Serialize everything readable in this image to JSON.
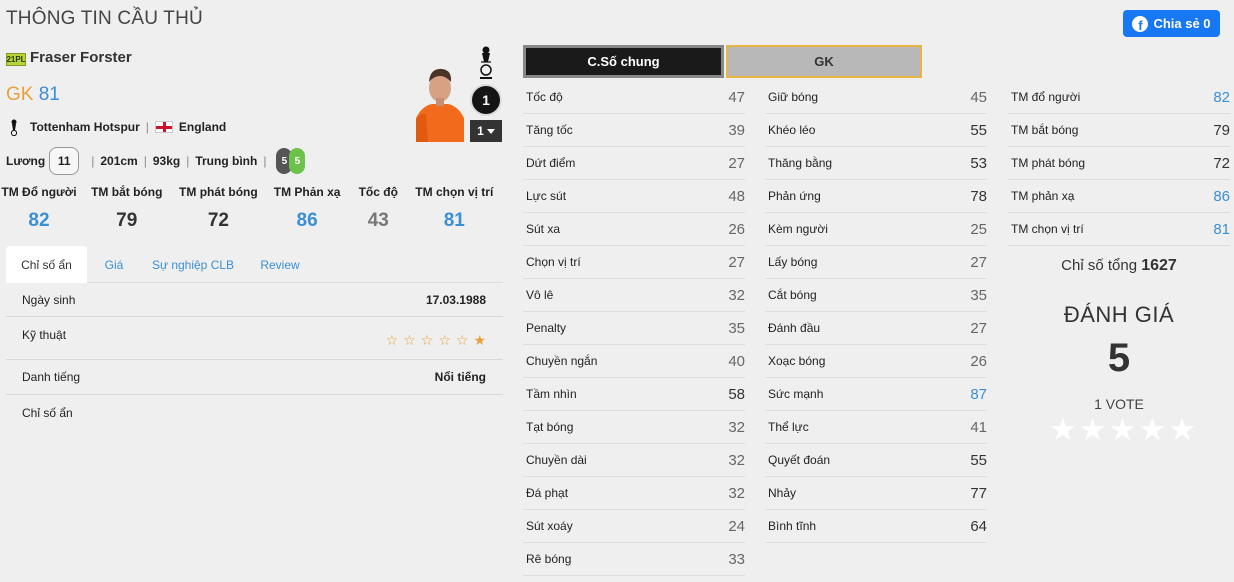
{
  "page_title": "THÔNG TIN CẦU THỦ",
  "share": {
    "label": "Chia sẻ 0",
    "fb_glyph": "f"
  },
  "player": {
    "season": "21PL",
    "name": "Fraser Forster",
    "position": "GK",
    "overall": "81",
    "club": "Tottenham Hotspur",
    "nation": "England",
    "wage_label": "Lương",
    "wage": "11",
    "height": "201cm",
    "weight": "93kg",
    "body_type": "Trung bình",
    "weak_foot_left": "5",
    "weak_foot_right": "5",
    "sep": "|",
    "jersey_number": "1",
    "jersey_select": "1"
  },
  "gk_stats": [
    {
      "label": "TM Đổ người",
      "value": "82",
      "color": "#3b8fd4"
    },
    {
      "label": "TM bắt bóng",
      "value": "79",
      "color": "#333333"
    },
    {
      "label": "TM phát bóng",
      "value": "72",
      "color": "#333333"
    },
    {
      "label": "TM Phản xạ",
      "value": "86",
      "color": "#3b8fd4"
    },
    {
      "label": "Tốc độ",
      "value": "43",
      "color": "#777777"
    },
    {
      "label": "TM chọn vị trí",
      "value": "81",
      "color": "#3b8fd4"
    }
  ],
  "tabs": [
    "Chỉ số ẩn",
    "Giá",
    "Sự nghiệp CLB",
    "Review"
  ],
  "info": {
    "birth_label": "Ngày sinh",
    "birth_value": "17.03.1988",
    "skill_label": "Kỹ thuật",
    "skill_stars": 1,
    "fame_label": "Danh tiếng",
    "fame_value": "Nổi tiếng",
    "hidden_label": "Chỉ số ẩn"
  },
  "stat_tabs": {
    "general": "C.Số chung",
    "gk": "GK"
  },
  "stats_col1": [
    {
      "label": "Tốc độ",
      "value": "47"
    },
    {
      "label": "Tăng tốc",
      "value": "39"
    },
    {
      "label": "Dứt điểm",
      "value": "27"
    },
    {
      "label": "Lực sút",
      "value": "48"
    },
    {
      "label": "Sút xa",
      "value": "26"
    },
    {
      "label": "Chọn vị trí",
      "value": "27"
    },
    {
      "label": "Vô lê",
      "value": "32"
    },
    {
      "label": "Penalty",
      "value": "35"
    },
    {
      "label": "Chuyền ngắn",
      "value": "40"
    },
    {
      "label": "Tầm nhìn",
      "value": "58"
    },
    {
      "label": "Tạt bóng",
      "value": "32"
    },
    {
      "label": "Chuyền dài",
      "value": "32"
    },
    {
      "label": "Đá phạt",
      "value": "32"
    },
    {
      "label": "Sút xoáy",
      "value": "24"
    },
    {
      "label": "Rê bóng",
      "value": "33"
    }
  ],
  "stats_col2": [
    {
      "label": "Giữ bóng",
      "value": "45"
    },
    {
      "label": "Khéo léo",
      "value": "55"
    },
    {
      "label": "Thăng bằng",
      "value": "53"
    },
    {
      "label": "Phản ứng",
      "value": "78"
    },
    {
      "label": "Kèm người",
      "value": "25"
    },
    {
      "label": "Lấy bóng",
      "value": "27"
    },
    {
      "label": "Cắt bóng",
      "value": "35"
    },
    {
      "label": "Đánh đầu",
      "value": "27"
    },
    {
      "label": "Xoạc bóng",
      "value": "26"
    },
    {
      "label": "Sức mạnh",
      "value": "87"
    },
    {
      "label": "Thể lực",
      "value": "41"
    },
    {
      "label": "Quyết đoán",
      "value": "55"
    },
    {
      "label": "Nhảy",
      "value": "77"
    },
    {
      "label": "Bình tĩnh",
      "value": "64"
    }
  ],
  "stats_col3": [
    {
      "label": "TM đổ người",
      "value": "82"
    },
    {
      "label": "TM bắt bóng",
      "value": "79"
    },
    {
      "label": "TM phát bóng",
      "value": "72"
    },
    {
      "label": "TM phản xạ",
      "value": "86"
    },
    {
      "label": "TM chọn vị trí",
      "value": "81"
    }
  ],
  "summary": {
    "total_label": "Chỉ số tổng",
    "total_value": "1627",
    "rating_title": "ĐÁNH GIÁ",
    "rating_value": "5",
    "votes": "1 VOTE",
    "vote_stars": 5
  },
  "colors": {
    "high": "#3b8fd4",
    "normal": "#333333",
    "low": "#777777",
    "accent": "#e8a13a",
    "share": "#1877f2"
  },
  "icons": {
    "club_crest": "spurs-crest-icon",
    "flag": "england-flag-icon",
    "rating_star": "star-icon",
    "share": "facebook-icon",
    "dropdown": "chevron-down-icon"
  }
}
